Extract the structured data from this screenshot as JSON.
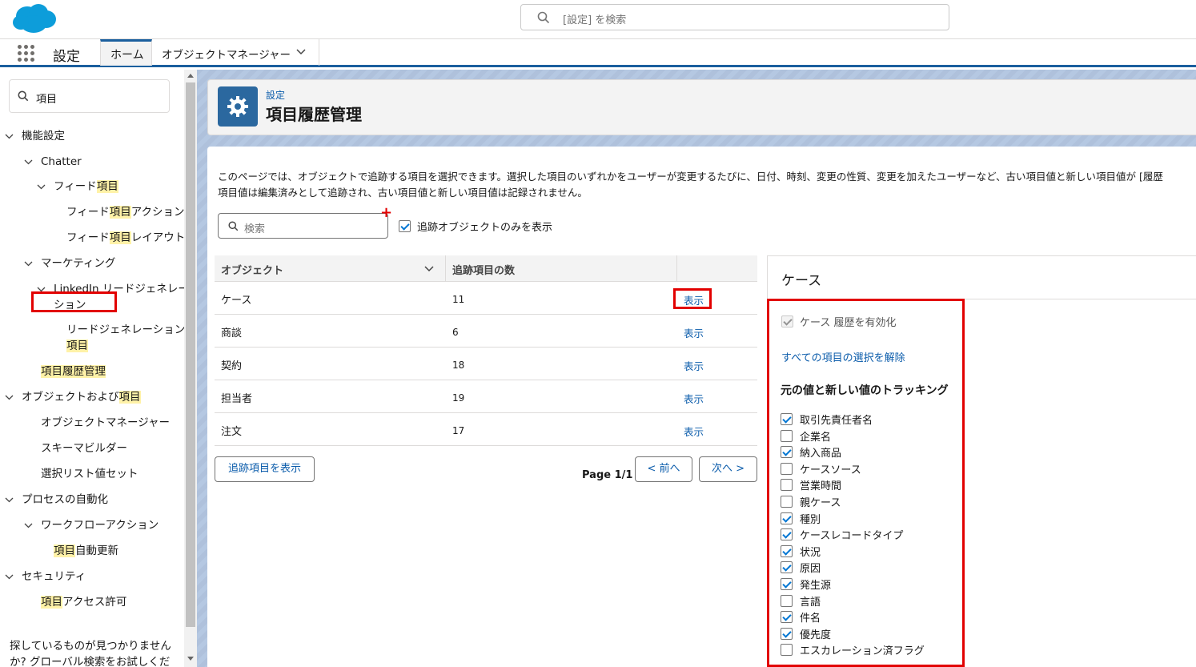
{
  "header": {
    "search_placeholder": "[設定] を検索"
  },
  "nav": {
    "app_name": "設定",
    "tabs": [
      {
        "label": "ホーム"
      },
      {
        "label": "オブジェクトマネージャー"
      }
    ]
  },
  "sidebar": {
    "search_value": "項目",
    "items": {
      "feature_settings": "機能設定",
      "chatter": "Chatter",
      "feed_pre": "フィード",
      "feed_hl": "項目",
      "feed_action_pre": "フィード",
      "feed_action_hl": "項目",
      "feed_action_post": "アクション",
      "feed_layout_pre": "フィード",
      "feed_layout_hl": "項目",
      "feed_layout_post": "レイアウト",
      "marketing": "マーケティング",
      "linkedin_line1": "LinkedIn リードジェネレー",
      "linkedin_line2": "ション",
      "leadgen_line1": "リードジェネレーション",
      "leadgen_hl": "項目",
      "field_history": "項目履歴管理",
      "obj_fields_pre": "オブジェクトおよび",
      "obj_fields_hl": "項目",
      "object_manager": "オブジェクトマネージャー",
      "schema_builder": "スキーマビルダー",
      "picklist_sets": "選択リスト値セット",
      "process_automation": "プロセスの自動化",
      "workflow_actions": "ワークフローアクション",
      "field_update_hl": "項目",
      "field_update_post": "自動更新",
      "security": "セキュリティ",
      "field_access_hl": "項目",
      "field_access_post": "アクセス許可"
    },
    "help_text_1": "探しているものが見つかりません",
    "help_text_2": "か? グローバル検索をお試しくださ"
  },
  "page": {
    "breadcrumb": "設定",
    "title": "項目履歴管理",
    "description_1": "このページでは、オブジェクトで追跡する項目を選択できます。選択した項目のいずれかをユーザーが変更するたびに、日付、時刻、変更の性質、変更を加えたユーザーなど、古い項目値と新しい項目値が [履歴",
    "description_2": "項目値は編集済みとして追跡され、古い項目値と新しい項目値は記録されません。",
    "search_placeholder": "検索",
    "tracked_only_label": "追跡オブジェクトのみを表示",
    "tracked_only_checked": true
  },
  "table": {
    "col_object": "オブジェクト",
    "col_count": "追跡項目の数",
    "rows": [
      {
        "name": "ケース",
        "count": "11",
        "action": "表示"
      },
      {
        "name": "商談",
        "count": "6",
        "action": "表示"
      },
      {
        "name": "契約",
        "count": "18",
        "action": "表示"
      },
      {
        "name": "担当者",
        "count": "19",
        "action": "表示"
      },
      {
        "name": "注文",
        "count": "17",
        "action": "表示"
      }
    ],
    "show_tracked_button": "追跡項目を表示",
    "page_label": "Page 1/1",
    "prev_button": "< 前へ",
    "next_button": "次へ >"
  },
  "detail": {
    "title": "ケース",
    "enable_label": "ケース 履歴を有効化",
    "deselect_all": "すべての項目の選択を解除",
    "section_title": "元の値と新しい値のトラッキング",
    "fields": [
      {
        "label": "取引先責任者名",
        "checked": true
      },
      {
        "label": "企業名",
        "checked": false
      },
      {
        "label": "納入商品",
        "checked": true
      },
      {
        "label": "ケースソース",
        "checked": false
      },
      {
        "label": "営業時間",
        "checked": false
      },
      {
        "label": "親ケース",
        "checked": false
      },
      {
        "label": "種別",
        "checked": true
      },
      {
        "label": "ケースレコードタイプ",
        "checked": true
      },
      {
        "label": "状況",
        "checked": true
      },
      {
        "label": "原因",
        "checked": true
      },
      {
        "label": "発生源",
        "checked": true
      },
      {
        "label": "言語",
        "checked": false
      },
      {
        "label": "件名",
        "checked": true
      },
      {
        "label": "優先度",
        "checked": true
      },
      {
        "label": "エスカレーション済フラグ",
        "checked": false
      }
    ]
  },
  "colors": {
    "brand": "#1b5f9e",
    "link": "#0b5cab",
    "highlight": "#fff2a8",
    "annotation_red": "#e20000"
  }
}
